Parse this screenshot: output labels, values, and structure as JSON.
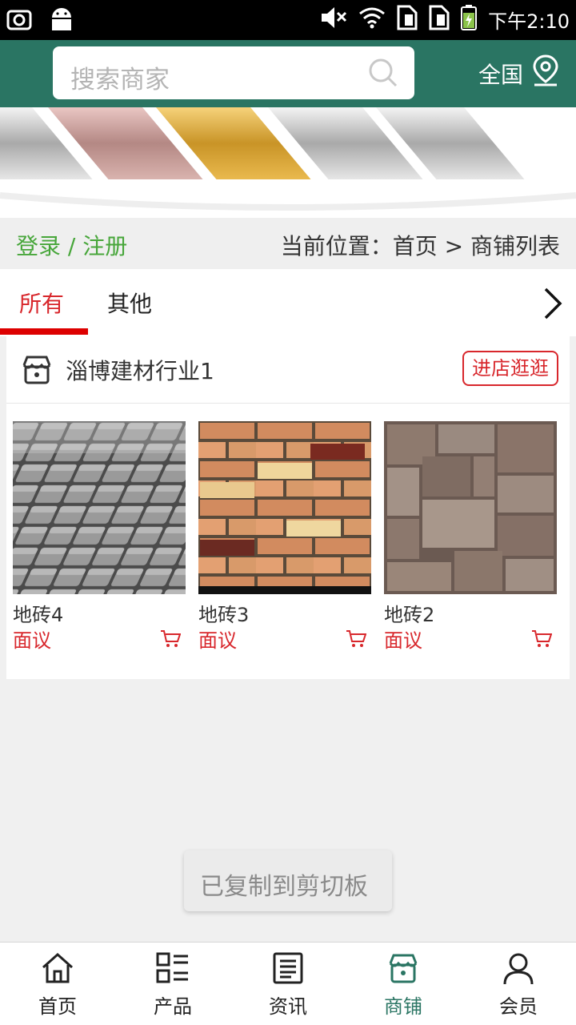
{
  "status_bar": {
    "time": "下午2:10",
    "left_icons": [
      "screenshot-icon",
      "android-icon"
    ],
    "right_icons": [
      "mute-icon",
      "wifi-icon",
      "sim1-icon",
      "sim2-icon",
      "battery-charging-icon"
    ]
  },
  "header": {
    "search_placeholder": "搜索商家",
    "region_label": "全国",
    "bg_color": "#2a7563"
  },
  "crumb": {
    "login_register": "登录 / 注册",
    "location": "当前位置：首页 > 商铺列表"
  },
  "tabs": [
    {
      "label": "所有",
      "active": true
    },
    {
      "label": "其他",
      "active": false
    }
  ],
  "shop": {
    "name": "淄博建材行业1",
    "visit_button": "进店逛逛",
    "products": [
      {
        "name": "地砖4",
        "price": "面议"
      },
      {
        "name": "地砖3",
        "price": "面议"
      },
      {
        "name": "地砖2",
        "price": "面议"
      }
    ]
  },
  "toast": "已复制到剪切板",
  "bottom_nav": [
    {
      "label": "首页",
      "icon": "home-icon",
      "active": false
    },
    {
      "label": "产品",
      "icon": "list-icon",
      "active": false
    },
    {
      "label": "资讯",
      "icon": "news-icon",
      "active": false
    },
    {
      "label": "商铺",
      "icon": "store-icon",
      "active": true
    },
    {
      "label": "会员",
      "icon": "user-icon",
      "active": false
    }
  ],
  "colors": {
    "accent_red": "#d8272c",
    "login_green": "#47a63a",
    "brand_teal": "#2a7563"
  }
}
